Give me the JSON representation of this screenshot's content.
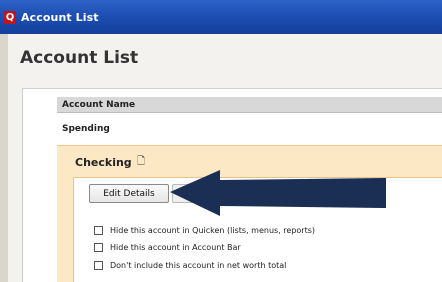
{
  "window": {
    "app_icon": "Q",
    "title": "Account List"
  },
  "page": {
    "title": "Account List"
  },
  "table": {
    "column_header": "Account Name",
    "groups": [
      {
        "label": "Spending"
      }
    ]
  },
  "account": {
    "name": "Checking",
    "edit_button": "Edit Details",
    "options": [
      {
        "label": "Hide this account in Quicken (lists, menus, reports)",
        "checked": false
      },
      {
        "label": "Hide this account in Account Bar",
        "checked": false
      },
      {
        "label": "Don't include this account in net worth total",
        "checked": false
      }
    ]
  },
  "annotation": {
    "arrow_color": "#1b2f55"
  }
}
